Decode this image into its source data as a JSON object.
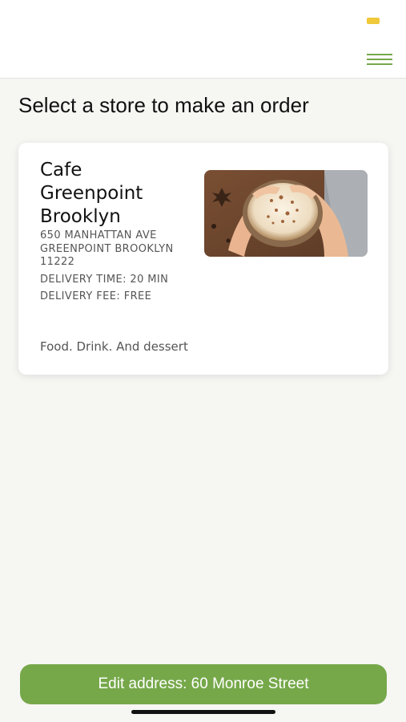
{
  "header": {
    "menu_icon": "hamburger-menu-icon",
    "accent_color": "#76a84a"
  },
  "page": {
    "title": "Select a store to make an order"
  },
  "stores": [
    {
      "name": "Cafe Greenpoint Brooklyn",
      "address": "650 MANHATTAN AVE GREENPOINT BROOKLYN 11222",
      "delivery_time": "DELIVERY TIME: 20 MIN",
      "delivery_fee": "DELIVERY FEE: FREE",
      "tagline": "Food. Drink. And dessert",
      "image": "latte-cup-photo"
    }
  ],
  "footer": {
    "edit_address_label": "Edit address: 60 Monroe Street",
    "button_color": "#76a84a"
  }
}
